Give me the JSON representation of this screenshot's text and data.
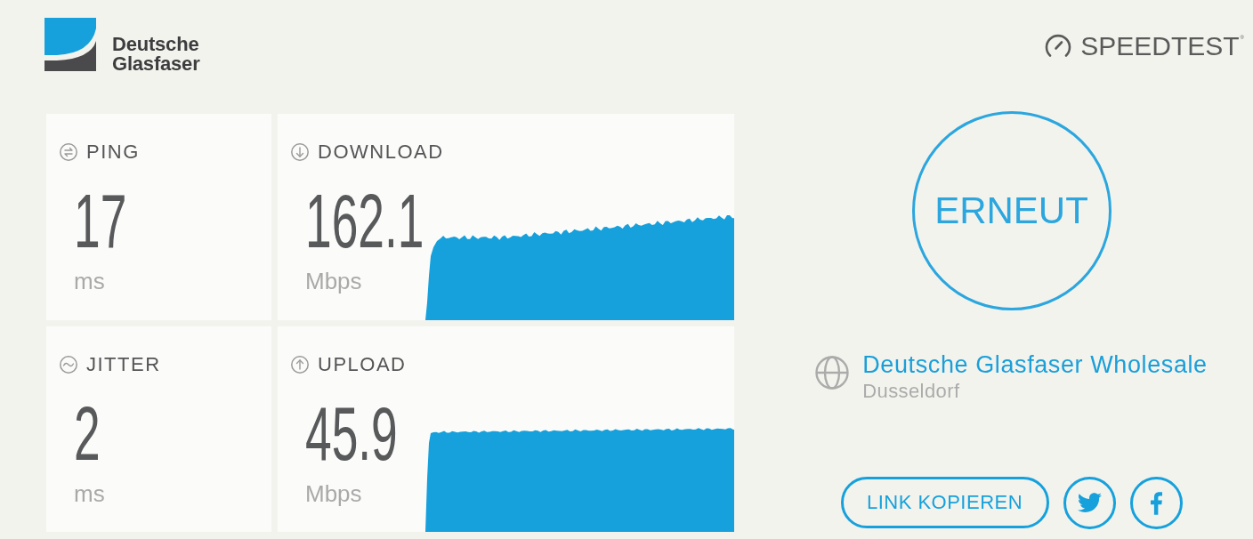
{
  "header": {
    "brand_name": "Deutsche Glasfaser",
    "speedtest_logo": "SPEEDTEST$^{®}$"
  },
  "metrics": [
    {
      "kind": "latency",
      "label": "PING",
      "value": "17",
      "unit": "ms"
    },
    {
      "kind": "speed",
      "label": "DOWNLOAD",
      "value": "162.1",
      "unit": "Mbps"
    },
    {
      "kind": "latency",
      "label": "JITTER",
      "value": "2",
      "unit": "ms"
    },
    {
      "kind": "speed",
      "label": "UPLOAD",
      "value": "45.9",
      "unit": "Mbps"
    }
  ],
  "restart_button": "ERNEUT",
  "server": {
    "name": "Deutsche Glasfaser Wholesale",
    "location": "Dusseldorf"
  },
  "share": {
    "copy_link_button": "LINK KOPIEREN"
  }
}
